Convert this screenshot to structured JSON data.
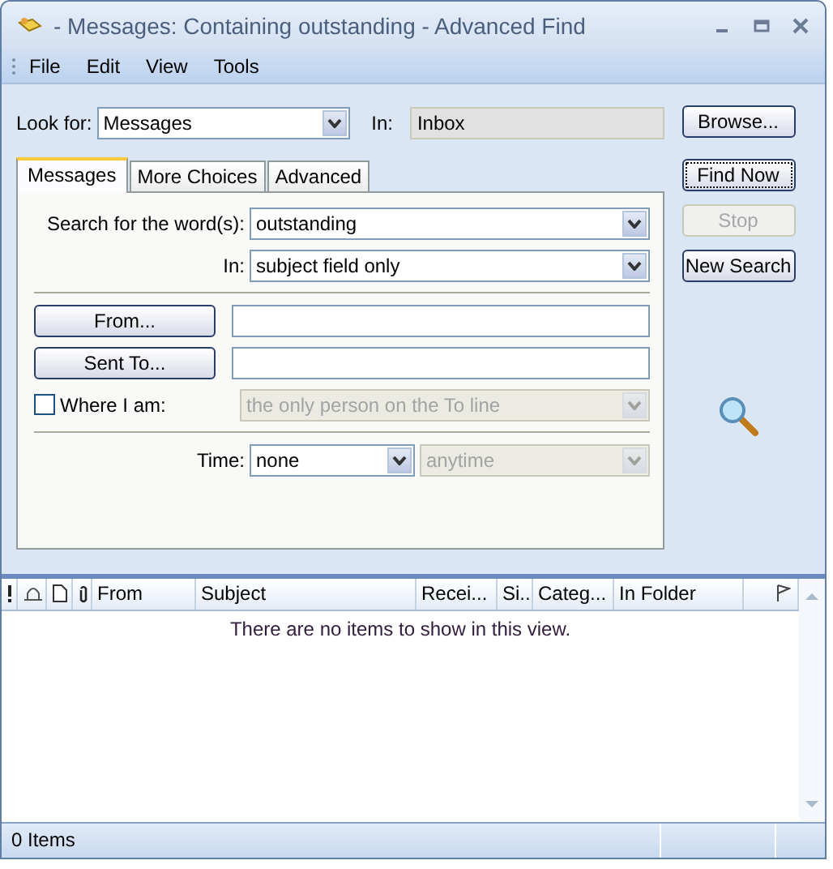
{
  "window": {
    "title": "- Messages: Containing outstanding - Advanced Find"
  },
  "menu": [
    "File",
    "Edit",
    "View",
    "Tools"
  ],
  "look_for": {
    "label": "Look for:",
    "value": "Messages"
  },
  "in_folder": {
    "label": "In:",
    "value": "Inbox"
  },
  "side_buttons": [
    {
      "label": "Browse...",
      "disabled": false
    },
    {
      "label": "Find Now",
      "disabled": false
    },
    {
      "label": "Stop",
      "disabled": true
    },
    {
      "label": "New Search",
      "disabled": false
    }
  ],
  "tabs": [
    {
      "label": "Messages",
      "selected": true
    },
    {
      "label": "More Choices",
      "selected": false
    },
    {
      "label": "Advanced",
      "selected": false
    }
  ],
  "search_words": {
    "label": "Search for the word(s):",
    "value": "outstanding"
  },
  "search_in": {
    "label": "In:",
    "value": "subject field only"
  },
  "from_button": "From...",
  "sent_to_button": "Sent To...",
  "where_i_am": {
    "label": "Where I am:",
    "checked": false,
    "value": "the only person on the To line",
    "disabled": true
  },
  "time": {
    "label": "Time:",
    "value": "none",
    "range": "anytime",
    "range_disabled": true
  },
  "results": {
    "columns": [
      {
        "kind": "importance"
      },
      {
        "kind": "reminder"
      },
      {
        "kind": "type"
      },
      {
        "kind": "attachment"
      },
      {
        "kind": "text",
        "label": "From"
      },
      {
        "kind": "text",
        "label": "Subject"
      },
      {
        "kind": "text",
        "label": "Recei..."
      },
      {
        "kind": "text",
        "label": "Si..."
      },
      {
        "kind": "text",
        "label": "Categ..."
      },
      {
        "kind": "text",
        "label": "In Folder"
      },
      {
        "kind": "flag"
      }
    ],
    "empty_message": "There are no items to show in this view."
  },
  "status_bar": {
    "text": "0 Items"
  }
}
